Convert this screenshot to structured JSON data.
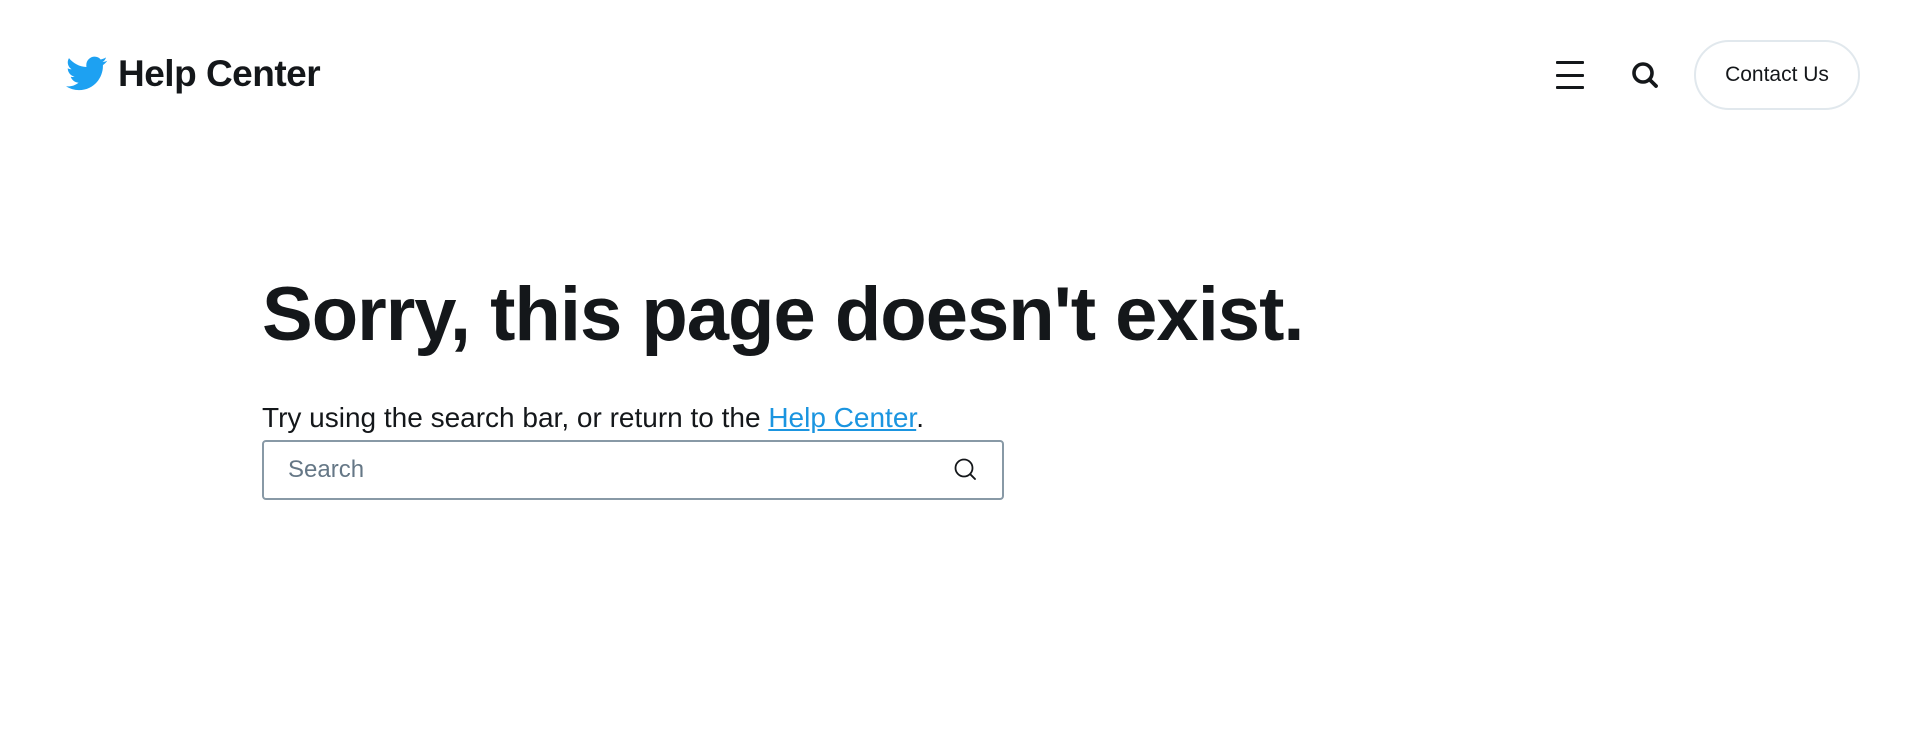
{
  "header": {
    "brand_title": "Help Center",
    "contact_label": "Contact Us"
  },
  "icons": {
    "brand": "twitter-bird-icon",
    "menu": "hamburger-menu-icon",
    "search_toggle": "search-icon",
    "search_submit": "search-icon"
  },
  "main": {
    "title": "Sorry, this page doesn't exist.",
    "helper_prefix": "Try using the search bar, or return to the ",
    "helper_link": "Help Center",
    "helper_suffix": ".",
    "search_placeholder": "Search"
  },
  "colors": {
    "brand_blue": "#1da1f2",
    "link_blue": "#1b95e0",
    "text": "#14171a",
    "input_border": "#8899a6",
    "button_border": "#e1e8ed"
  }
}
